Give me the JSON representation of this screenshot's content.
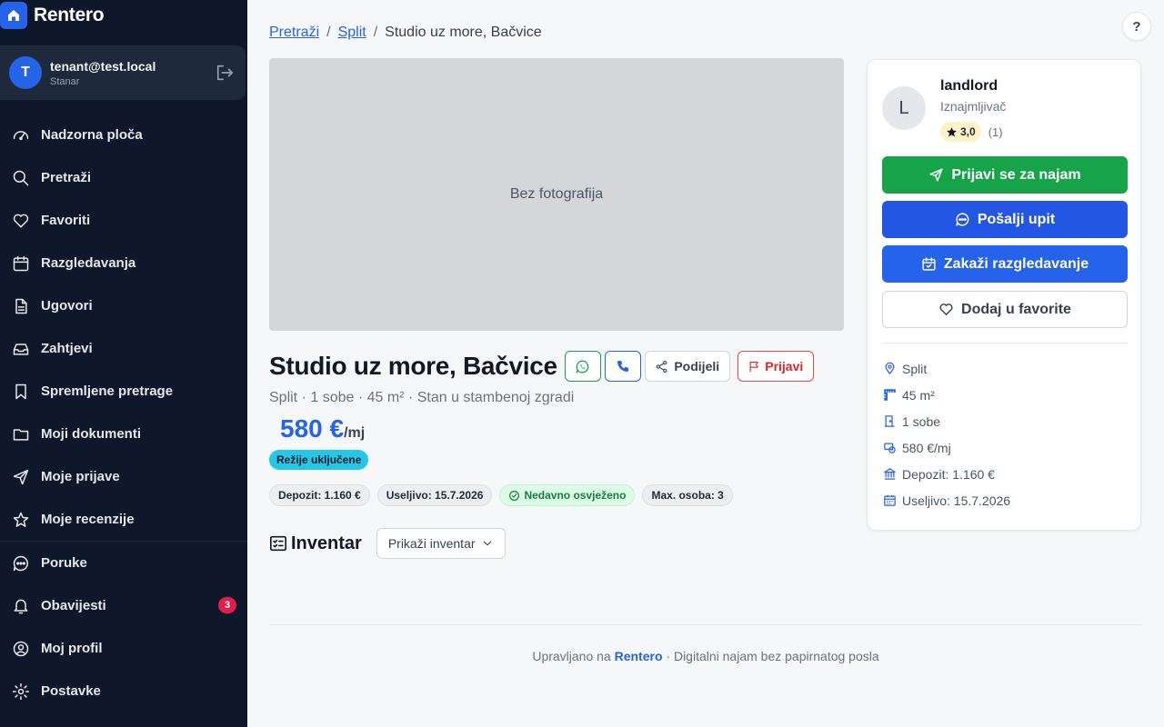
{
  "brand": {
    "name": "Rentero"
  },
  "user": {
    "initial": "T",
    "email": "tenant@test.local",
    "role": "Stanar"
  },
  "nav": {
    "items": [
      {
        "label": "Nadzorna ploča"
      },
      {
        "label": "Pretraži"
      },
      {
        "label": "Favoriti"
      },
      {
        "label": "Razgledavanja"
      },
      {
        "label": "Ugovori"
      },
      {
        "label": "Zahtjevi"
      },
      {
        "label": "Spremljene pretrage"
      },
      {
        "label": "Moji dokumenti"
      },
      {
        "label": "Moje prijave"
      },
      {
        "label": "Moje recenzije"
      }
    ],
    "bottom": [
      {
        "label": "Poruke"
      },
      {
        "label": "Obavijesti",
        "badge": "3"
      },
      {
        "label": "Moj profil"
      },
      {
        "label": "Postavke"
      }
    ]
  },
  "breadcrumb": {
    "search": "Pretraži",
    "city": "Split",
    "current": "Studio uz more, Bačvice",
    "sep": "/"
  },
  "help": {
    "label": "?"
  },
  "listing": {
    "photo_placeholder": "Bez fotografija",
    "title": "Studio uz more, Bačvice",
    "share_label": "Podijeli",
    "report_label": "Prijavi",
    "subtitle": "Split · 1 sobe · 45 m² · Stan u stambenoj zgradi",
    "price": "580 €",
    "price_unit": "/mj",
    "utilities_badge": "Režije uključene",
    "chips": {
      "deposit": "Depozit: 1.160 €",
      "available": "Useljivo: 15.7.2026",
      "refreshed": "Nedavno osvježeno",
      "max_people": "Max. osoba: 3"
    },
    "inventory_title": "Inventar",
    "inventory_button": "Prikaži inventar"
  },
  "landlord": {
    "initial": "L",
    "name": "landlord",
    "role": "Iznajmljivač",
    "rating": "3,0",
    "rating_count": "(1)"
  },
  "actions": {
    "apply": "Prijavi se za najam",
    "inquiry": "Pošalji upit",
    "viewing": "Zakaži razgledavanje",
    "favorite": "Dodaj u favorite"
  },
  "facts": {
    "city": "Split",
    "area": "45 m²",
    "rooms": "1 sobe",
    "price": "580 €/mj",
    "deposit": "Depozit: 1.160 €",
    "available": "Useljivo: 15.7.2026"
  },
  "footer": {
    "prefix": "Upravljano na",
    "brand": "Rentero",
    "suffix": "· Digitalni najam bez papirnatog posla"
  },
  "colors": {
    "sidebar": "#0f172a",
    "accent": "#2563eb",
    "green": "#16a34a",
    "danger": "#dc2626"
  }
}
